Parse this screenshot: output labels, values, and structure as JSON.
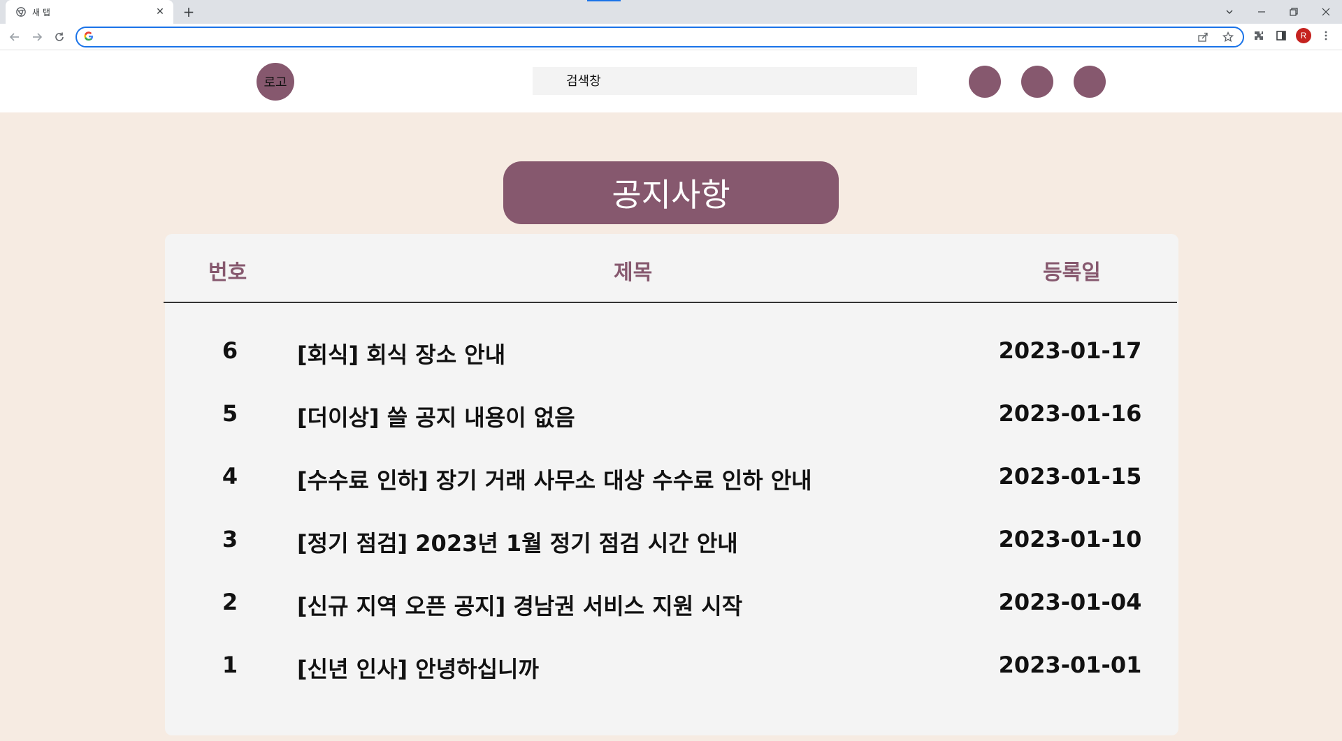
{
  "browser": {
    "tab_title": "새 탭",
    "tab_close": "✕",
    "new_tab": "+",
    "address_value": "",
    "profile_initial": "R",
    "icons": [
      "chrome-icon",
      "back-icon",
      "forward-icon",
      "reload-icon",
      "google-icon",
      "share-icon",
      "star-icon",
      "extensions-icon",
      "sidepanel-icon",
      "menu-icon"
    ]
  },
  "header": {
    "logo_label": "로고",
    "search_placeholder": "검색창",
    "accent_color": "#86586e"
  },
  "board": {
    "title": "공지사항",
    "columns": {
      "number": "번호",
      "title": "제목",
      "date": "등록일"
    },
    "rows": [
      {
        "number": "6",
        "title": "[회식] 회식 장소 안내",
        "date": "2023-01-17"
      },
      {
        "number": "5",
        "title": "[더이상] 쓸 공지 내용이 없음",
        "date": "2023-01-16"
      },
      {
        "number": "4",
        "title": "[수수료 인하] 장기 거래 사무소 대상 수수료 인하 안내",
        "date": "2023-01-15"
      },
      {
        "number": "3",
        "title": "[정기 점검] 2023년 1월 정기 점검 시간 안내",
        "date": "2023-01-10"
      },
      {
        "number": "2",
        "title": "[신규 지역 오픈 공지] 경남권 서비스 지원 시작",
        "date": "2023-01-04"
      },
      {
        "number": "1",
        "title": "[신년 인사] 안녕하십니까",
        "date": "2023-01-01"
      }
    ]
  },
  "colors": {
    "background": "#f6ebe2",
    "panel": "#f4f4f4",
    "accent": "#86586e"
  }
}
